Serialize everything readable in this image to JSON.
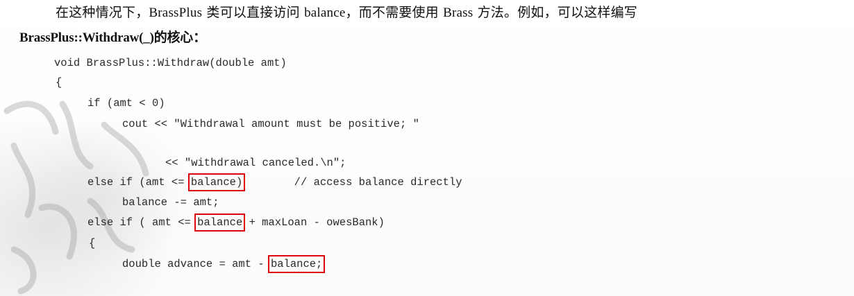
{
  "prose": {
    "line1": {
      "part1": "在这种情况下，",
      "class_name": "BrassPlus",
      "part2": " 类可以直接访问 ",
      "member": "balance",
      "part3": "，而不需要使用 ",
      "base_class": "Brass",
      "part4": " 方法。例如，可以这样编写"
    },
    "line2": {
      "func": "BrassPlus::Withdraw(_)",
      "part": "的核心："
    }
  },
  "code": {
    "l1": "void BrassPlus::Withdraw(double amt)",
    "l2": "{",
    "l3": "if (amt < 0)",
    "l4": "cout << \"Withdrawal amount must be positive; \"",
    "l5": "<< \"withdrawal canceled.\\n\";",
    "l6_pre": "else if (amt <= ",
    "l6_hl": "balance)",
    "l6_post": "        // access balance directly",
    "l7": "balance -= amt;",
    "l8_pre": "else if ( amt <= ",
    "l8_hl": "balance",
    "l8_post": " + maxLoan - owesBank)",
    "l9": "{",
    "l10_pre": "double advance = amt - ",
    "l10_hl": "balance;"
  },
  "colors": {
    "highlight_box": "#e0000a",
    "text": "#1a1a1a"
  }
}
